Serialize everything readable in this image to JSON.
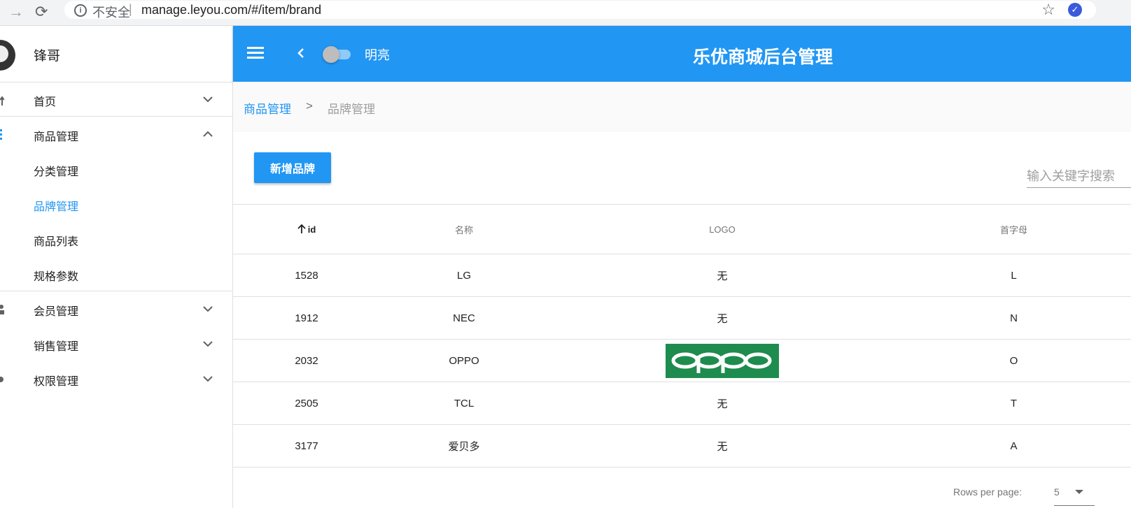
{
  "browser": {
    "security_label": "不安全",
    "separator": "|",
    "url": "manage.leyou.com/#/item/brand"
  },
  "sidebar": {
    "username": "锋哥",
    "items": [
      {
        "label": "首页"
      },
      {
        "label": "商品管理"
      },
      {
        "label": "分类管理"
      },
      {
        "label": "品牌管理"
      },
      {
        "label": "商品列表"
      },
      {
        "label": "规格参数"
      },
      {
        "label": "会员管理"
      },
      {
        "label": "销售管理"
      },
      {
        "label": "权限管理"
      }
    ],
    "active_item": "品牌管理"
  },
  "topbar": {
    "toggle_label": "明亮",
    "title": "乐优商城后台管理"
  },
  "breadcrumb": {
    "parent": "商品管理",
    "separator": ">",
    "current": "品牌管理"
  },
  "toolbar": {
    "add_label": "新增品牌",
    "search_placeholder": "输入关键字搜索"
  },
  "table": {
    "headers": [
      "id",
      "名称",
      "LOGO",
      "首字母"
    ],
    "rows": [
      {
        "id": "1528",
        "name": "LG",
        "logo": "无",
        "letter": "L"
      },
      {
        "id": "1912",
        "name": "NEC",
        "logo": "无",
        "letter": "N"
      },
      {
        "id": "2032",
        "name": "OPPO",
        "logo": "oppo",
        "letter": "O"
      },
      {
        "id": "2505",
        "name": "TCL",
        "logo": "无",
        "letter": "T"
      },
      {
        "id": "3177",
        "name": "爱贝多",
        "logo": "无",
        "letter": "A"
      }
    ]
  },
  "pagination": {
    "rows_per_page_label": "Rows per page:",
    "rows_per_page": "5"
  },
  "colors": {
    "primary": "#2196f3",
    "oppo_logo": "#1e8c4e"
  },
  "icons": [
    "arrow-forward-icon",
    "reload-icon",
    "info-icon",
    "star-icon",
    "extension-icon",
    "menu-icon",
    "chevron-left-icon",
    "chevron-down-icon",
    "chevron-up-icon",
    "arrow-up-icon"
  ]
}
